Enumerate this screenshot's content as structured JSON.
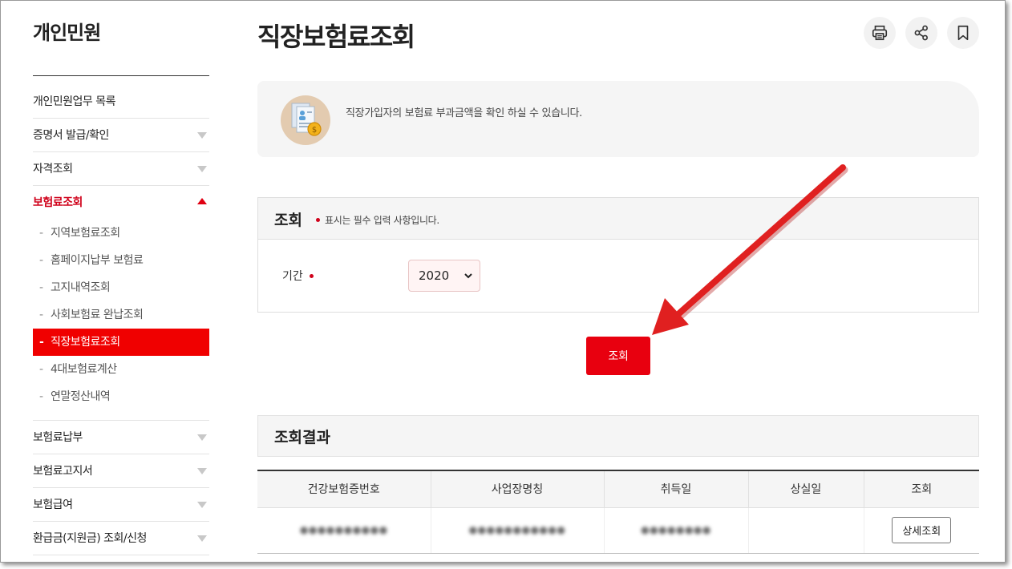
{
  "sidebar": {
    "title": "개인민원",
    "items": [
      {
        "label": "개인민원업무 목록",
        "has_arrow": false
      },
      {
        "label": "증명서 발급/확인",
        "has_arrow": true
      },
      {
        "label": "자격조회",
        "has_arrow": true
      },
      {
        "label": "보험료조회",
        "has_arrow": true,
        "active": true
      }
    ],
    "sub_items": [
      {
        "label": "지역보험료조회"
      },
      {
        "label": "홈페이지납부 보험료"
      },
      {
        "label": "고지내역조회"
      },
      {
        "label": "사회보험료 완납조회"
      },
      {
        "label": "직장보험료조회",
        "selected": true
      },
      {
        "label": "4대보험료계산"
      },
      {
        "label": "연말정산내역"
      }
    ],
    "items_after": [
      {
        "label": "보험료납부"
      },
      {
        "label": "보험료고지서"
      },
      {
        "label": "보험급여"
      },
      {
        "label": "환급금(지원금) 조회/신청"
      }
    ]
  },
  "header": {
    "title": "직장보험료조회",
    "tools": [
      "print-icon",
      "share-icon",
      "bookmark-icon"
    ]
  },
  "info": {
    "text": "직장가입자의 보험료 부과금액을 확인 하실 수 있습니다.",
    "icon": "document-coin-icon"
  },
  "search": {
    "title": "조회",
    "required_note": "표시는 필수 입력 사항입니다.",
    "period_label": "기간",
    "year_value": "2020",
    "button_label": "조회"
  },
  "results": {
    "title": "조회결과",
    "columns": [
      "건강보험증번호",
      "사업장명칭",
      "취득일",
      "상실일",
      "조회"
    ],
    "rows": [
      {
        "insurance_no": "●●●●●●●●●●",
        "workplace": "●●●●●●●●●●●",
        "acquired": "●●●●●●●●",
        "lost": "",
        "action": "상세조회"
      }
    ]
  },
  "colors": {
    "accent": "#e8000f",
    "active_text": "#d0021b",
    "panel_bg": "#f5f5f5",
    "annotation_arrow": "#e02020"
  }
}
